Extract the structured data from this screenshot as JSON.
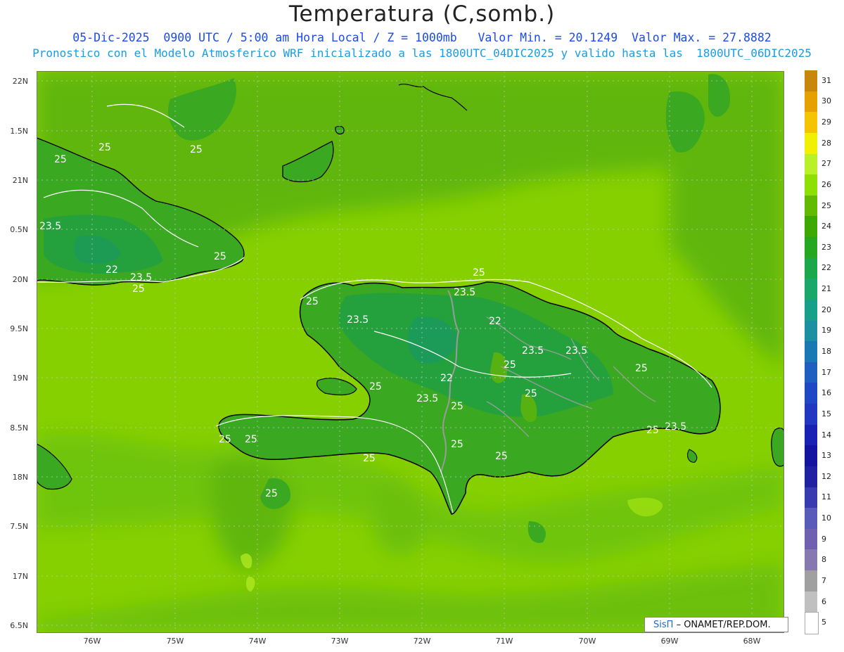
{
  "title": "Temperatura (C,somb.)",
  "subtitle_line1": "05-Dic-2025  0900 UTC / 5:00 am Hora Local / Z = 1000mb   Valor Min. = 20.1249  Valor Max. = 27.8882",
  "subtitle_line2": "Pronostico con el Modelo Atmosferico WRF inicializado a las 1800UTC_04DIC2025 y valido hasta las  1800UTC_06DIC2025",
  "lat_labels": [
    "22N",
    "1.5N",
    "21N",
    "0.5N",
    "20N",
    "9.5N",
    "19N",
    "8.5N",
    "18N",
    "7.5N",
    "17N",
    "6.5N"
  ],
  "lon_labels": [
    "76W",
    "75W",
    "74W",
    "73W",
    "72W",
    "71W",
    "70W",
    "69W",
    "68W"
  ],
  "legend": {
    "levels": [
      "31",
      "30",
      "29",
      "28",
      "27",
      "26",
      "25",
      "24",
      "23",
      "22",
      "21",
      "20",
      "19",
      "18",
      "17",
      "16",
      "15",
      "14",
      "13",
      "12",
      "11",
      "10",
      "9",
      "8",
      "7",
      "6",
      "5"
    ],
    "colors": [
      "#c8860a",
      "#e6a000",
      "#f5c400",
      "#f0f000",
      "#b9f028",
      "#8ee000",
      "#63b800",
      "#3da800",
      "#24a820",
      "#1aa84a",
      "#1aa86a",
      "#16a08a",
      "#1a90a0",
      "#1a78b4",
      "#1e60c0",
      "#1e48c4",
      "#2238c0",
      "#1a22b4",
      "#1414a0",
      "#2020a0",
      "#3a3ab0",
      "#5a5ab8",
      "#7060b0",
      "#8878b0",
      "#a0a0a0",
      "#c0c0c0",
      "#ffffff"
    ]
  },
  "contour_labels": [
    "25",
    "25",
    "25",
    "25",
    "25",
    "25",
    "25",
    "25",
    "25",
    "25",
    "25",
    "25",
    "25",
    "25",
    "25",
    "25",
    "25",
    "25",
    "25",
    "23.5",
    "23.5",
    "23.5",
    "23.5",
    "23.5",
    "23.5",
    "23.5",
    "23.5",
    "22",
    "22",
    "22"
  ],
  "credit": {
    "brand": "SisΠ",
    "text": "– ONAMET/REP.DOM."
  },
  "colors": {
    "sea_light": "#8ad400",
    "sea_mid": "#6cbf10",
    "land_dark": "#3aa820",
    "land_darker": "#22a040",
    "border": "#000000",
    "contour": "#ffffff"
  }
}
